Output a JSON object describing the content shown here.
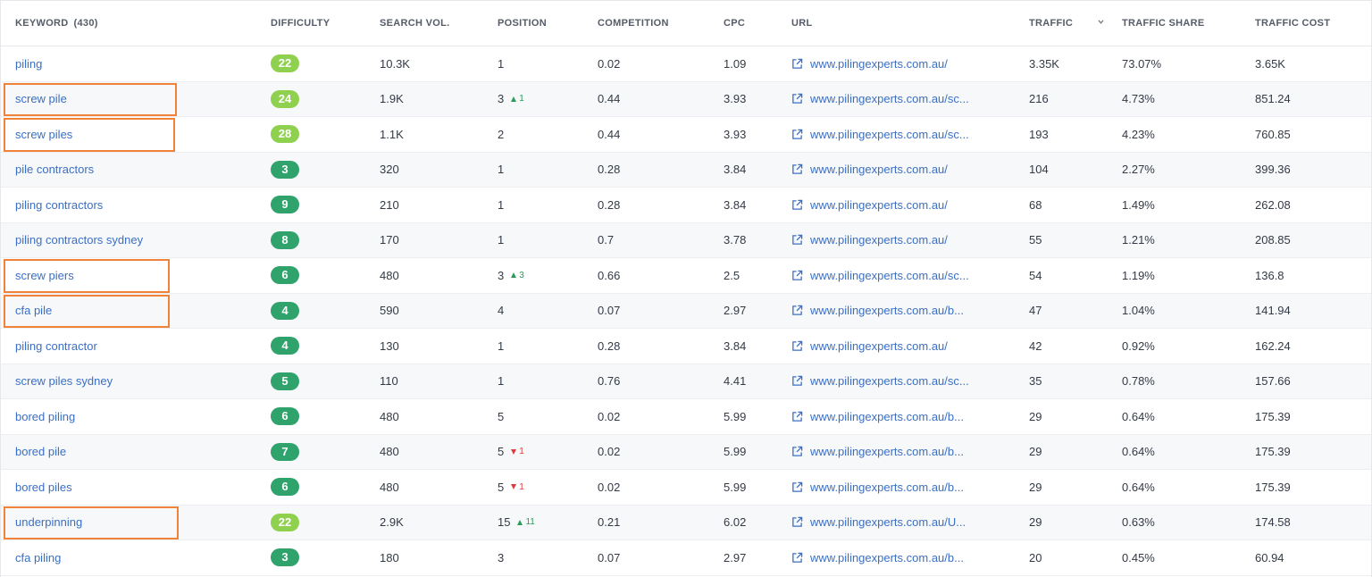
{
  "header": {
    "keyword": "KEYWORD",
    "keyword_count": "(430)",
    "difficulty": "DIFFICULTY",
    "search_vol": "SEARCH VOL.",
    "position": "POSITION",
    "competition": "COMPETITION",
    "cpc": "CPC",
    "url": "URL",
    "traffic": "TRAFFIC",
    "traffic_share": "TRAFFIC SHARE",
    "traffic_cost": "TRAFFIC COST"
  },
  "colors": {
    "badge_light": "#8fd14f",
    "badge_dark": "#2fa36b",
    "link": "#3b6fc4",
    "highlight": "#f0823a",
    "up": "#2a9c5a",
    "down": "#e03a3a"
  },
  "rows": [
    {
      "keyword": "piling",
      "difficulty": "22",
      "diff_style": "light",
      "volume": "10.3K",
      "position": "1",
      "delta": "",
      "delta_dir": "",
      "competition": "0.02",
      "cpc": "1.09",
      "url": "www.pilingexperts.com.au/",
      "traffic": "3.35K",
      "share": "73.07%",
      "cost": "3.65K",
      "highlighted": false
    },
    {
      "keyword": "screw pile",
      "difficulty": "24",
      "diff_style": "light",
      "volume": "1.9K",
      "position": "3",
      "delta": "1",
      "delta_dir": "up",
      "competition": "0.44",
      "cpc": "3.93",
      "url": "www.pilingexperts.com.au/sc...",
      "traffic": "216",
      "share": "4.73%",
      "cost": "851.24",
      "highlighted": true
    },
    {
      "keyword": "screw piles",
      "difficulty": "28",
      "diff_style": "light",
      "volume": "1.1K",
      "position": "2",
      "delta": "",
      "delta_dir": "",
      "competition": "0.44",
      "cpc": "3.93",
      "url": "www.pilingexperts.com.au/sc...",
      "traffic": "193",
      "share": "4.23%",
      "cost": "760.85",
      "highlighted": true
    },
    {
      "keyword": "pile contractors",
      "difficulty": "3",
      "diff_style": "dark",
      "volume": "320",
      "position": "1",
      "delta": "",
      "delta_dir": "",
      "competition": "0.28",
      "cpc": "3.84",
      "url": "www.pilingexperts.com.au/",
      "traffic": "104",
      "share": "2.27%",
      "cost": "399.36",
      "highlighted": false
    },
    {
      "keyword": "piling contractors",
      "difficulty": "9",
      "diff_style": "dark",
      "volume": "210",
      "position": "1",
      "delta": "",
      "delta_dir": "",
      "competition": "0.28",
      "cpc": "3.84",
      "url": "www.pilingexperts.com.au/",
      "traffic": "68",
      "share": "1.49%",
      "cost": "262.08",
      "highlighted": false
    },
    {
      "keyword": "piling contractors sydney",
      "difficulty": "8",
      "diff_style": "dark",
      "volume": "170",
      "position": "1",
      "delta": "",
      "delta_dir": "",
      "competition": "0.7",
      "cpc": "3.78",
      "url": "www.pilingexperts.com.au/",
      "traffic": "55",
      "share": "1.21%",
      "cost": "208.85",
      "highlighted": false
    },
    {
      "keyword": "screw piers",
      "difficulty": "6",
      "diff_style": "dark",
      "volume": "480",
      "position": "3",
      "delta": "3",
      "delta_dir": "up",
      "competition": "0.66",
      "cpc": "2.5",
      "url": "www.pilingexperts.com.au/sc...",
      "traffic": "54",
      "share": "1.19%",
      "cost": "136.8",
      "highlighted": true
    },
    {
      "keyword": "cfa pile",
      "difficulty": "4",
      "diff_style": "dark",
      "volume": "590",
      "position": "4",
      "delta": "",
      "delta_dir": "",
      "competition": "0.07",
      "cpc": "2.97",
      "url": "www.pilingexperts.com.au/b...",
      "traffic": "47",
      "share": "1.04%",
      "cost": "141.94",
      "highlighted": true
    },
    {
      "keyword": "piling contractor",
      "difficulty": "4",
      "diff_style": "dark",
      "volume": "130",
      "position": "1",
      "delta": "",
      "delta_dir": "",
      "competition": "0.28",
      "cpc": "3.84",
      "url": "www.pilingexperts.com.au/",
      "traffic": "42",
      "share": "0.92%",
      "cost": "162.24",
      "highlighted": false
    },
    {
      "keyword": "screw piles sydney",
      "difficulty": "5",
      "diff_style": "dark",
      "volume": "110",
      "position": "1",
      "delta": "",
      "delta_dir": "",
      "competition": "0.76",
      "cpc": "4.41",
      "url": "www.pilingexperts.com.au/sc...",
      "traffic": "35",
      "share": "0.78%",
      "cost": "157.66",
      "highlighted": false
    },
    {
      "keyword": "bored piling",
      "difficulty": "6",
      "diff_style": "dark",
      "volume": "480",
      "position": "5",
      "delta": "",
      "delta_dir": "",
      "competition": "0.02",
      "cpc": "5.99",
      "url": "www.pilingexperts.com.au/b...",
      "traffic": "29",
      "share": "0.64%",
      "cost": "175.39",
      "highlighted": false
    },
    {
      "keyword": "bored pile",
      "difficulty": "7",
      "diff_style": "dark",
      "volume": "480",
      "position": "5",
      "delta": "1",
      "delta_dir": "down",
      "competition": "0.02",
      "cpc": "5.99",
      "url": "www.pilingexperts.com.au/b...",
      "traffic": "29",
      "share": "0.64%",
      "cost": "175.39",
      "highlighted": false
    },
    {
      "keyword": "bored piles",
      "difficulty": "6",
      "diff_style": "dark",
      "volume": "480",
      "position": "5",
      "delta": "1",
      "delta_dir": "down",
      "competition": "0.02",
      "cpc": "5.99",
      "url": "www.pilingexperts.com.au/b...",
      "traffic": "29",
      "share": "0.64%",
      "cost": "175.39",
      "highlighted": false
    },
    {
      "keyword": "underpinning",
      "difficulty": "22",
      "diff_style": "light",
      "volume": "2.9K",
      "position": "15",
      "delta": "11",
      "delta_dir": "up",
      "competition": "0.21",
      "cpc": "6.02",
      "url": "www.pilingexperts.com.au/U...",
      "traffic": "29",
      "share": "0.63%",
      "cost": "174.58",
      "highlighted": true
    },
    {
      "keyword": "cfa piling",
      "difficulty": "3",
      "diff_style": "dark",
      "volume": "180",
      "position": "3",
      "delta": "",
      "delta_dir": "",
      "competition": "0.07",
      "cpc": "2.97",
      "url": "www.pilingexperts.com.au/b...",
      "traffic": "20",
      "share": "0.45%",
      "cost": "60.94",
      "highlighted": false
    }
  ]
}
